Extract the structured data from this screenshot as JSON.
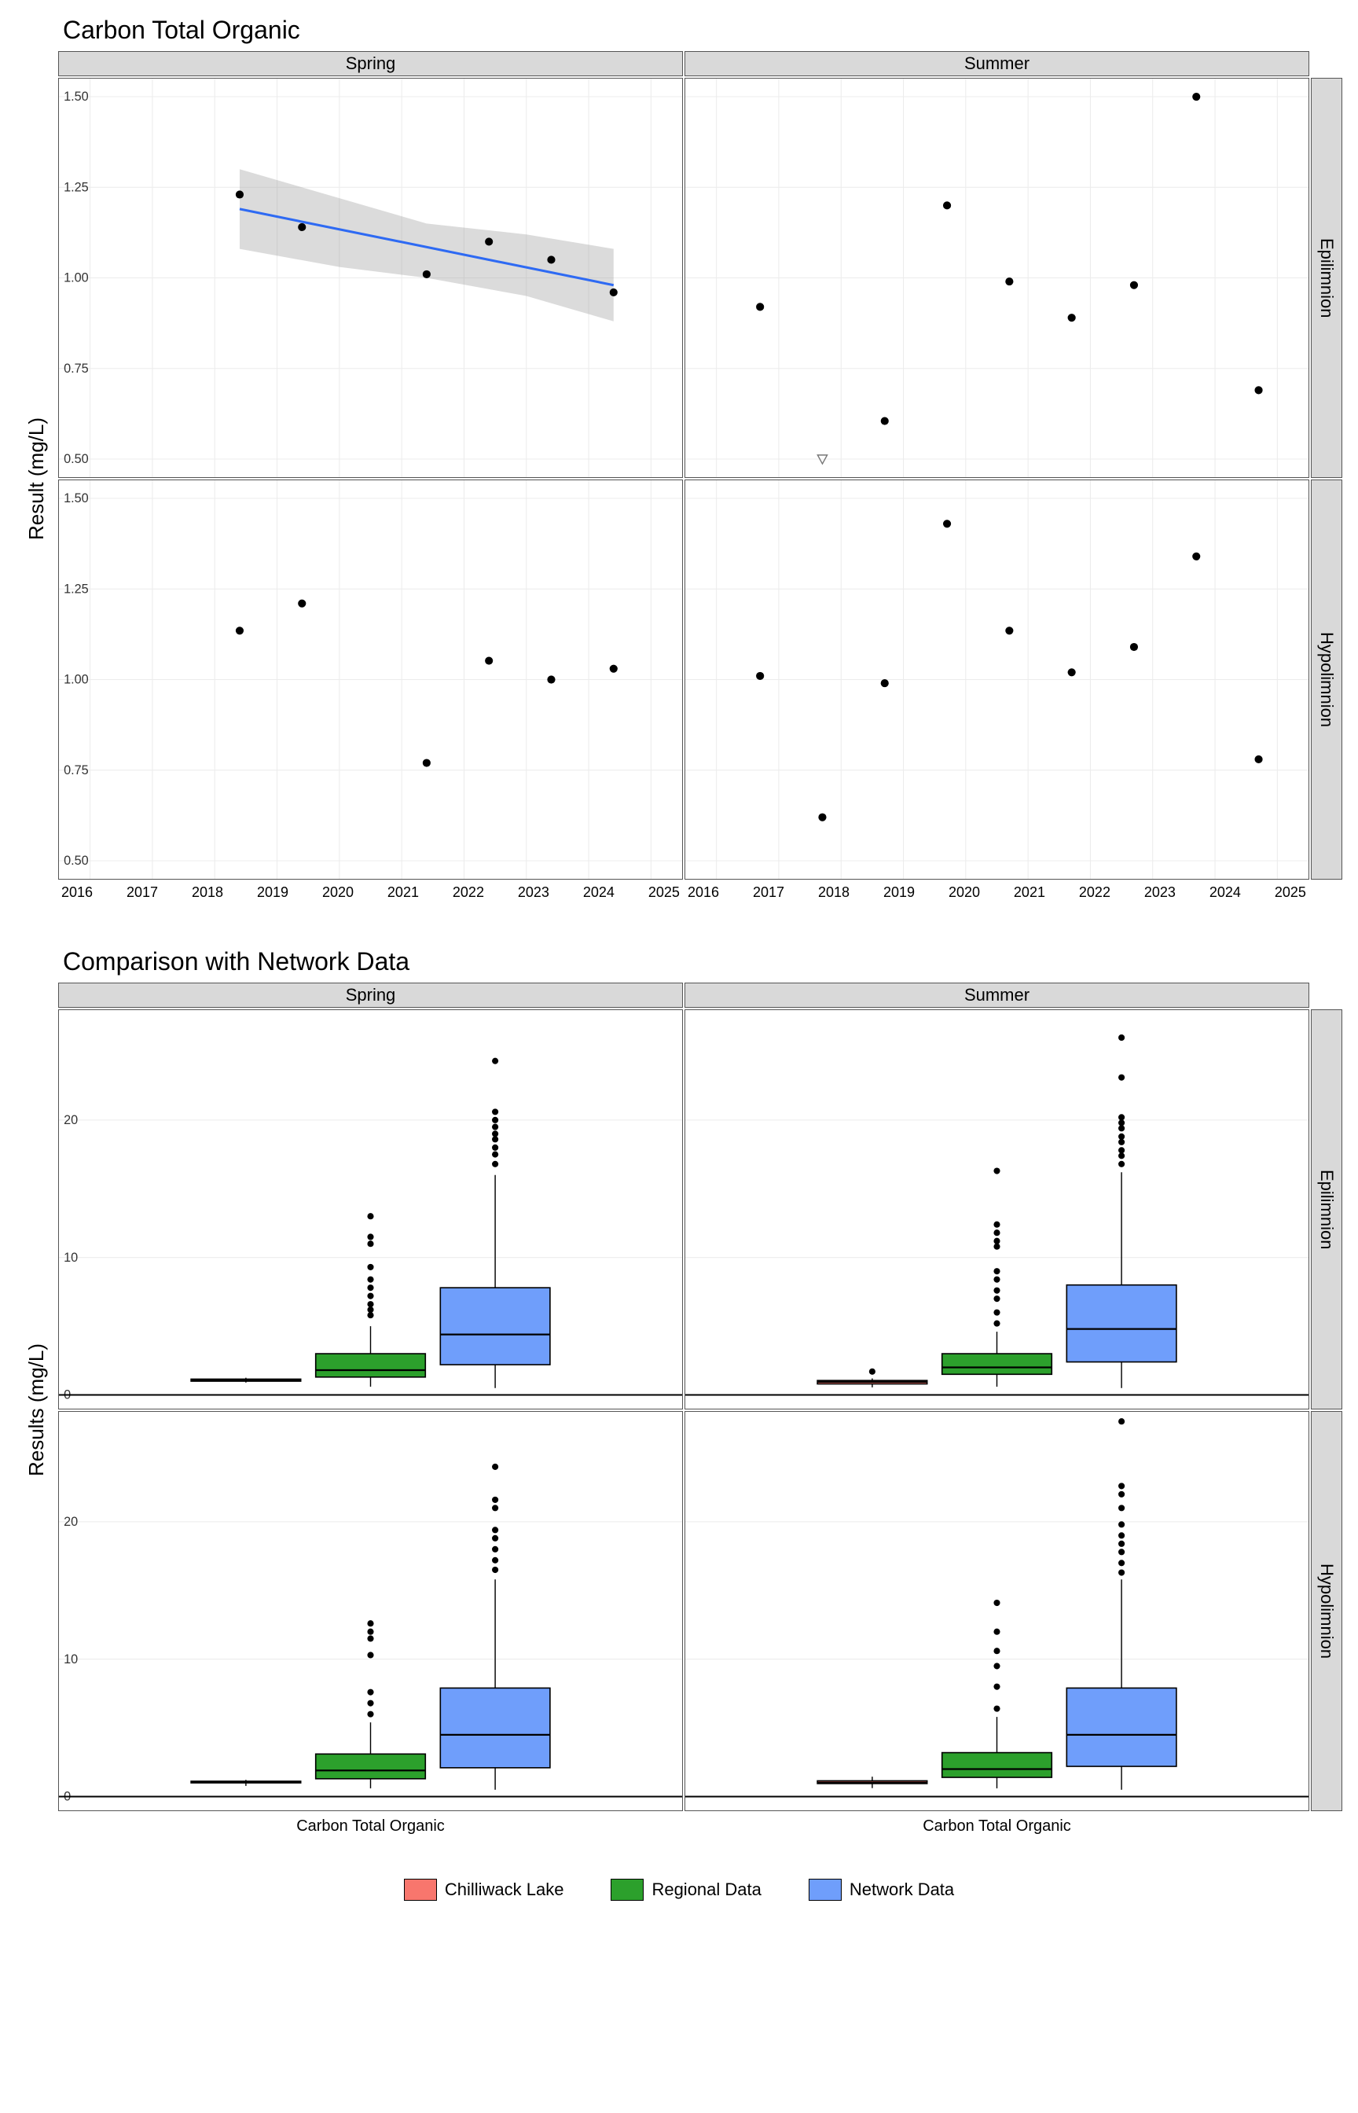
{
  "chart_data": [
    {
      "type": "scatter",
      "title": "Carbon Total Organic",
      "ylabel": "Result (mg/L)",
      "ylim": [
        0.45,
        1.55
      ],
      "y_ticks": [
        0.5,
        0.75,
        1.0,
        1.25,
        1.5
      ],
      "xlim": [
        2015.5,
        2025.5
      ],
      "x_ticks": [
        2016,
        2017,
        2018,
        2019,
        2020,
        2021,
        2022,
        2023,
        2024,
        2025
      ],
      "facets": {
        "cols": [
          "Spring",
          "Summer"
        ],
        "rows": [
          "Epilimnion",
          "Hypolimnion"
        ]
      },
      "panels": {
        "Spring|Epilimnion": {
          "points": [
            [
              2018.4,
              1.23
            ],
            [
              2019.4,
              1.14
            ],
            [
              2021.4,
              1.01
            ],
            [
              2022.4,
              1.1
            ],
            [
              2023.4,
              1.05
            ],
            [
              2024.4,
              0.96
            ]
          ],
          "trend": {
            "x0": 2018.4,
            "y0": 1.19,
            "x1": 2024.4,
            "y1": 0.98
          },
          "ribbon": [
            [
              2018.4,
              1.08,
              1.3
            ],
            [
              2020.0,
              1.03,
              1.22
            ],
            [
              2021.4,
              1.0,
              1.15
            ],
            [
              2023.0,
              0.95,
              1.12
            ],
            [
              2024.4,
              0.88,
              1.08
            ]
          ]
        },
        "Summer|Epilimnion": {
          "points": [
            [
              2016.7,
              0.92
            ],
            [
              2018.7,
              0.605
            ],
            [
              2019.7,
              1.2
            ],
            [
              2020.7,
              0.99
            ],
            [
              2021.7,
              0.89
            ],
            [
              2022.7,
              0.98
            ],
            [
              2023.7,
              1.5
            ],
            [
              2024.7,
              0.69
            ]
          ],
          "special": [
            [
              2017.7,
              0.5
            ]
          ]
        },
        "Spring|Hypolimnion": {
          "points": [
            [
              2018.4,
              1.135
            ],
            [
              2019.4,
              1.21
            ],
            [
              2021.4,
              0.77
            ],
            [
              2022.4,
              1.052
            ],
            [
              2023.4,
              1.0
            ],
            [
              2024.4,
              1.03
            ]
          ]
        },
        "Summer|Hypolimnion": {
          "points": [
            [
              2016.7,
              1.01
            ],
            [
              2017.7,
              0.62
            ],
            [
              2018.7,
              0.99
            ],
            [
              2019.7,
              1.43
            ],
            [
              2020.7,
              1.135
            ],
            [
              2021.7,
              1.02
            ],
            [
              2022.7,
              1.09
            ],
            [
              2023.7,
              1.34
            ],
            [
              2024.7,
              0.78
            ]
          ]
        }
      }
    },
    {
      "type": "box",
      "title": "Comparison with Network Data",
      "ylabel": "Results (mg/L)",
      "xlabel": "Carbon Total Organic",
      "ylim": [
        -1,
        28
      ],
      "y_ticks": [
        0,
        10,
        20
      ],
      "facets": {
        "cols": [
          "Spring",
          "Summer"
        ],
        "rows": [
          "Epilimnion",
          "Hypolimnion"
        ]
      },
      "series": [
        "Chilliwack Lake",
        "Regional Data",
        "Network Data"
      ],
      "colors": {
        "Chilliwack Lake": "#f8766d",
        "Regional Data": "#2ca02c",
        "Network Data": "#6f9efb"
      },
      "panels": {
        "Spring|Epilimnion": {
          "boxes": [
            {
              "name": "Chilliwack Lake",
              "min": 0.9,
              "q1": 1.0,
              "med": 1.07,
              "q3": 1.15,
              "max": 1.25,
              "outliers": []
            },
            {
              "name": "Regional Data",
              "min": 0.6,
              "q1": 1.3,
              "med": 1.8,
              "q3": 3.0,
              "max": 5.0,
              "outliers": [
                5.8,
                6.2,
                6.6,
                7.2,
                7.8,
                8.4,
                9.3,
                11.0,
                11.5,
                13.0
              ]
            },
            {
              "name": "Network Data",
              "min": 0.5,
              "q1": 2.2,
              "med": 4.4,
              "q3": 7.8,
              "max": 16.0,
              "outliers": [
                16.8,
                17.5,
                18.0,
                18.6,
                19.0,
                19.5,
                20.0,
                20.6,
                24.3
              ]
            }
          ]
        },
        "Summer|Epilimnion": {
          "boxes": [
            {
              "name": "Chilliwack Lake",
              "min": 0.55,
              "q1": 0.8,
              "med": 0.95,
              "q3": 1.05,
              "max": 1.2,
              "outliers": [
                1.7
              ]
            },
            {
              "name": "Regional Data",
              "min": 0.6,
              "q1": 1.5,
              "med": 2.0,
              "q3": 3.0,
              "max": 4.6,
              "outliers": [
                5.2,
                6.0,
                7.0,
                7.6,
                8.4,
                9.0,
                10.8,
                11.2,
                11.8,
                12.4,
                16.3
              ]
            },
            {
              "name": "Network Data",
              "min": 0.5,
              "q1": 2.4,
              "med": 4.8,
              "q3": 8.0,
              "max": 16.2,
              "outliers": [
                16.8,
                17.4,
                17.8,
                18.4,
                18.8,
                19.4,
                19.8,
                20.2,
                23.1,
                26.0
              ]
            }
          ]
        },
        "Spring|Hypolimnion": {
          "boxes": [
            {
              "name": "Chilliwack Lake",
              "min": 0.78,
              "q1": 1.0,
              "med": 1.04,
              "q3": 1.12,
              "max": 1.22,
              "outliers": []
            },
            {
              "name": "Regional Data",
              "min": 0.6,
              "q1": 1.3,
              "med": 1.9,
              "q3": 3.1,
              "max": 5.4,
              "outliers": [
                6.0,
                6.8,
                7.6,
                10.3,
                11.5,
                12.0,
                12.6
              ]
            },
            {
              "name": "Network Data",
              "min": 0.5,
              "q1": 2.1,
              "med": 4.5,
              "q3": 7.9,
              "max": 15.8,
              "outliers": [
                16.5,
                17.2,
                18.0,
                18.8,
                19.4,
                21.0,
                21.6,
                24.0
              ]
            }
          ]
        },
        "Summer|Hypolimnion": {
          "boxes": [
            {
              "name": "Chilliwack Lake",
              "min": 0.62,
              "q1": 0.95,
              "med": 1.02,
              "q3": 1.15,
              "max": 1.45,
              "outliers": []
            },
            {
              "name": "Regional Data",
              "min": 0.6,
              "q1": 1.4,
              "med": 2.0,
              "q3": 3.2,
              "max": 5.8,
              "outliers": [
                6.4,
                8.0,
                9.5,
                10.6,
                12.0,
                14.1
              ]
            },
            {
              "name": "Network Data",
              "min": 0.5,
              "q1": 2.2,
              "med": 4.5,
              "q3": 7.9,
              "max": 15.8,
              "outliers": [
                16.3,
                17.0,
                17.8,
                18.4,
                19.0,
                19.8,
                21.0,
                22.0,
                22.6,
                27.3
              ]
            }
          ]
        }
      },
      "legend": [
        {
          "label": "Chilliwack Lake",
          "fill": "#f8766d"
        },
        {
          "label": "Regional Data",
          "fill": "#2ca02c"
        },
        {
          "label": "Network Data",
          "fill": "#6f9efb"
        }
      ]
    }
  ]
}
